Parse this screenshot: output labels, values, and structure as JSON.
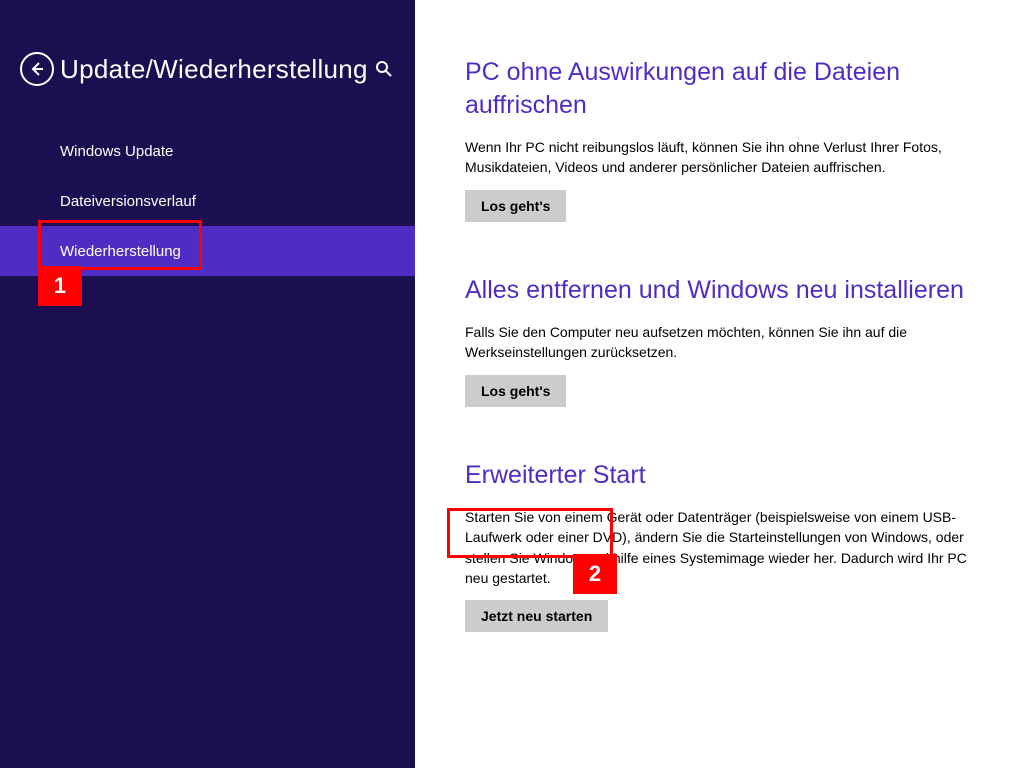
{
  "header": {
    "title": "Update/Wiederherstellung"
  },
  "nav": {
    "items": [
      {
        "label": "Windows Update",
        "selected": false
      },
      {
        "label": "Dateiversionsverlauf",
        "selected": false
      },
      {
        "label": "Wiederherstellung",
        "selected": true
      }
    ]
  },
  "sections": [
    {
      "heading": "PC ohne Auswirkungen auf die Dateien auffrischen",
      "body": "Wenn Ihr PC nicht reibungslos läuft, können Sie ihn ohne Verlust Ihrer Fotos, Musikdateien, Videos und anderer persönlicher Dateien auffrischen.",
      "button": "Los geht's"
    },
    {
      "heading": "Alles entfernen und Windows neu installieren",
      "body": "Falls Sie den Computer neu aufsetzen möchten, können Sie ihn auf die Werkseinstellungen zurücksetzen.",
      "button": "Los geht's"
    },
    {
      "heading": "Erweiterter Start",
      "body": "Starten Sie von einem Gerät oder Datenträger (beispielsweise von einem USB-Laufwerk oder einer DVD), ändern Sie die Starteinstellungen von Windows, oder stellen Sie Windows mithilfe eines Systemimage wieder her. Dadurch wird Ihr PC neu gestartet.",
      "button": "Jetzt neu starten"
    }
  ],
  "annotations": {
    "one": "1",
    "two": "2"
  }
}
